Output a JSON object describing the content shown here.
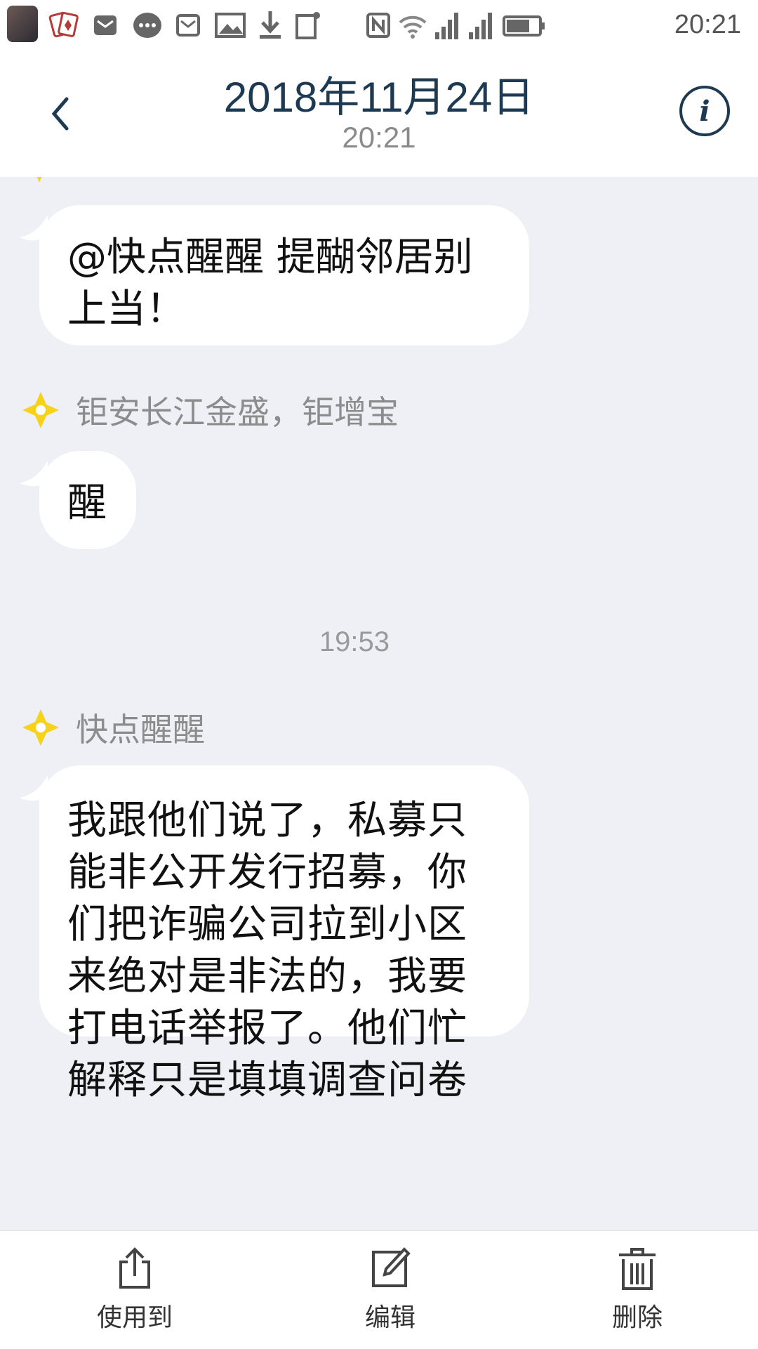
{
  "status_bar": {
    "time": "20:21",
    "icons": [
      "avatar",
      "cards-app-icon",
      "mail-icon",
      "chat-icon",
      "message-icon",
      "gallery-icon",
      "download-icon",
      "screenshot-icon",
      "nfc-icon",
      "wifi-icon",
      "signal-icon",
      "signal-icon",
      "battery-icon"
    ]
  },
  "header": {
    "title": "2018年11月24日",
    "subtitle": "20:21",
    "back_icon": "chevron-left-icon",
    "info_icon": "info-icon"
  },
  "conversation": {
    "messages": [
      {
        "text": "@快点醒醒 提醐邻居别上当！"
      },
      {
        "sender": "钜安长江金盛，钜增宝",
        "text": "醒"
      },
      {
        "timestamp": "19:53"
      },
      {
        "sender": "快点醒醒",
        "text": "我跟他们说了，私募只能非公开发行招募，你们把诈骗公司拉到小区来绝对是非法的，我要打电话举报了。他们忙解释只是填填调查问卷"
      }
    ]
  },
  "toolbar": {
    "items": [
      {
        "label": "使用到",
        "icon": "share-icon"
      },
      {
        "label": "编辑",
        "icon": "edit-icon"
      },
      {
        "label": "删除",
        "icon": "trash-icon"
      }
    ]
  },
  "colors": {
    "background": "#eef0f5",
    "bubble": "#ffffff",
    "header_text": "#1d3a52",
    "sender_badge": "#f7d21a"
  }
}
